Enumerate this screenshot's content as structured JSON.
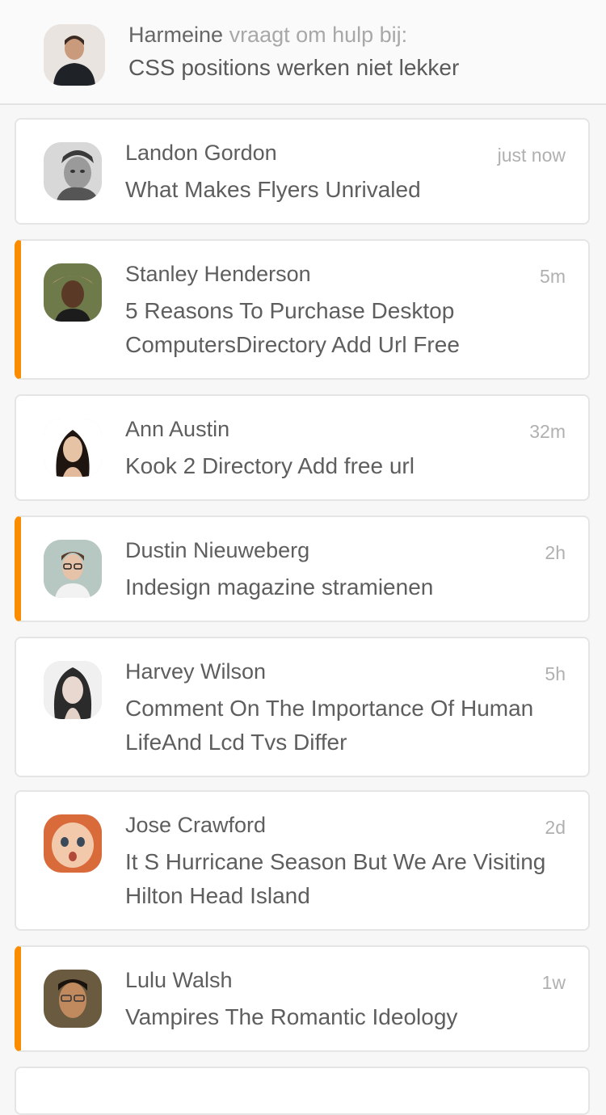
{
  "header": {
    "name": "Harmeine",
    "verb": "vraagt om hulp bij:",
    "topic": "CSS positions werken niet lekker",
    "avatar_icon": "user-photo-icon"
  },
  "accent_color": "#fb8c00",
  "notifications": [
    {
      "name": "Landon Gordon",
      "time": "just now",
      "message": "What Makes Flyers Unrivaled",
      "unread": false
    },
    {
      "name": "Stanley Henderson",
      "time": "5m",
      "message": "5 Reasons To Purchase Desktop ComputersDirectory Add Url Free",
      "unread": true
    },
    {
      "name": "Ann Austin",
      "time": "32m",
      "message": "Kook 2 Directory Add free url",
      "unread": false
    },
    {
      "name": "Dustin Nieuweberg",
      "time": "2h",
      "message": "Indesign magazine stramienen",
      "unread": true
    },
    {
      "name": "Harvey Wilson",
      "time": "5h",
      "message": "Comment On The Importance Of Human LifeAnd Lcd Tvs Differ",
      "unread": false
    },
    {
      "name": "Jose Crawford",
      "time": "2d",
      "message": "It S Hurricane Season But We Are Visiting Hilton Head Island",
      "unread": false
    },
    {
      "name": "Lulu Walsh",
      "time": "1w",
      "message": "Vampires The Romantic Ideology",
      "unread": true
    }
  ]
}
